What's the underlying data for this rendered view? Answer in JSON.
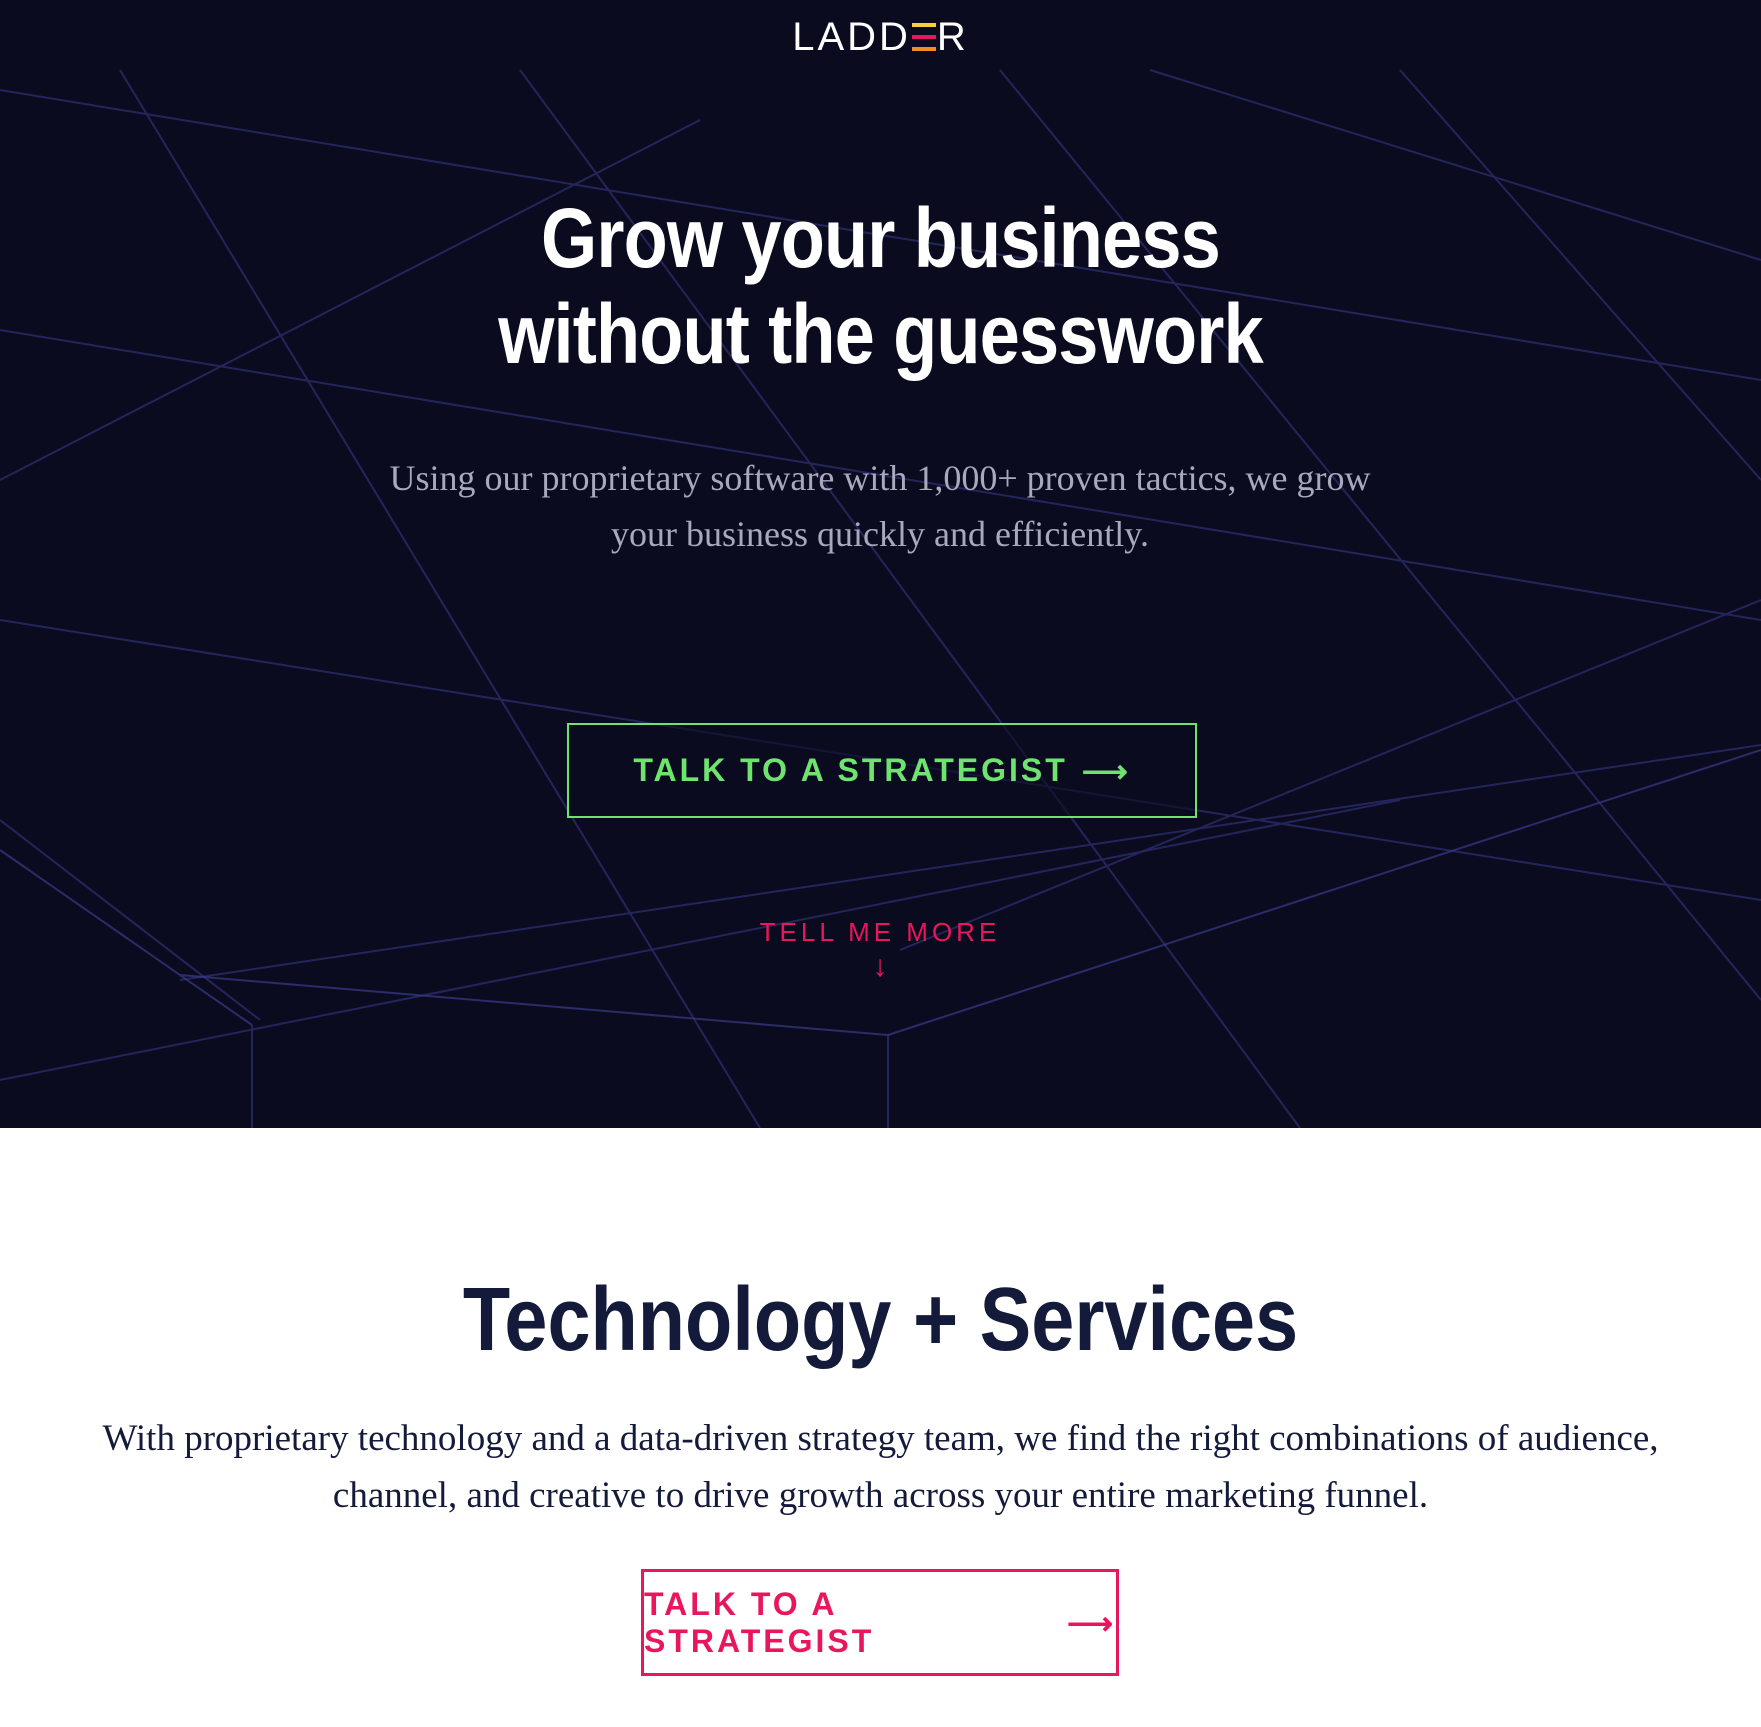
{
  "brand": {
    "logo_prefix": "LADD",
    "logo_suffix": "R",
    "logo_e_colors": [
      "#f7d03c",
      "#e8175d",
      "#f28c28"
    ]
  },
  "hero": {
    "title_line1": "Grow your business",
    "title_line2": "without the guesswork",
    "subtitle": "Using our proprietary software with 1,000+ proven tactics, we grow your business quickly and efficiently.",
    "cta_label": "TALK TO A STRATEGIST",
    "cta_arrow": "⟶",
    "tell_more_label": "TELL ME MORE",
    "tell_more_arrow": "↓"
  },
  "services": {
    "title": "Technology + Services",
    "description": "With proprietary technology and a data-driven strategy team, we find the right combinations of audience, channel, and creative to drive growth across your entire marketing funnel.",
    "cta_label": "TALK TO A STRATEGIST",
    "cta_arrow": "⟶"
  },
  "colors": {
    "hero_bg": "#0b0b1f",
    "accent_green": "#6fe36f",
    "accent_pink": "#e8175d",
    "navy_text": "#141a3a",
    "grid_line": "#2a2b63"
  }
}
